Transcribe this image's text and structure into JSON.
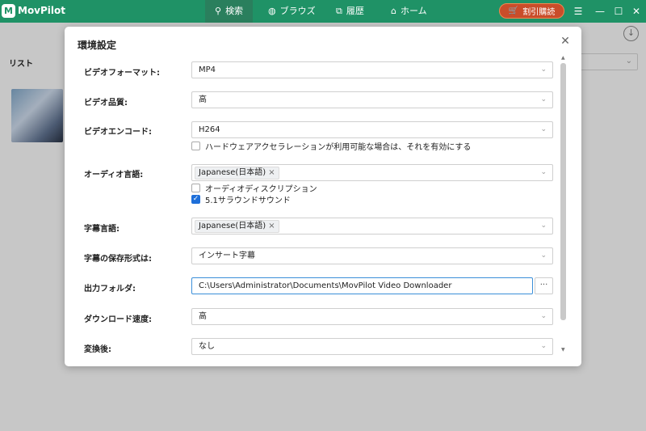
{
  "app": {
    "name": "MovPilot",
    "logo_letter": "M"
  },
  "nav": {
    "search": "検索",
    "browse": "ブラウズ",
    "history": "履歴",
    "home": "ホーム"
  },
  "discount_label": "割引購読",
  "background": {
    "list_label": "リスト"
  },
  "dialog": {
    "title": "環境設定",
    "video_format": {
      "label": "ビデオフォーマット:",
      "value": "MP4"
    },
    "video_quality": {
      "label": "ビデオ品質:",
      "value": "高"
    },
    "video_codec": {
      "label": "ビデオエンコード:",
      "value": "H264",
      "hw_accel_label": "ハードウェアアクセラレーションが利用可能な場合は、それを有効にする",
      "hw_accel_checked": false
    },
    "audio_language": {
      "label": "オーディオ言語:",
      "tag": "Japanese(日本語)",
      "audio_description_label": "オーディオディスクリプション",
      "audio_description_checked": false,
      "surround_label": "5.1サラウンドサウンド",
      "surround_checked": true
    },
    "subtitle_language": {
      "label": "字幕言語:",
      "tag": "Japanese(日本語)"
    },
    "subtitle_format": {
      "label": "字幕の保存形式は:",
      "value": "インサート字幕"
    },
    "output_folder": {
      "label": "出力フォルダ:",
      "value": "C:\\Users\\Administrator\\Documents\\MovPilot Video Downloader",
      "browse_label": "···"
    },
    "download_speed": {
      "label": "ダウンロード速度:",
      "value": "高"
    },
    "after_conversion": {
      "label": "変換後:",
      "value": "なし"
    }
  },
  "icons": {
    "chevron": "chevron-down-icon",
    "close": "close-icon",
    "tag_remove": "×"
  }
}
